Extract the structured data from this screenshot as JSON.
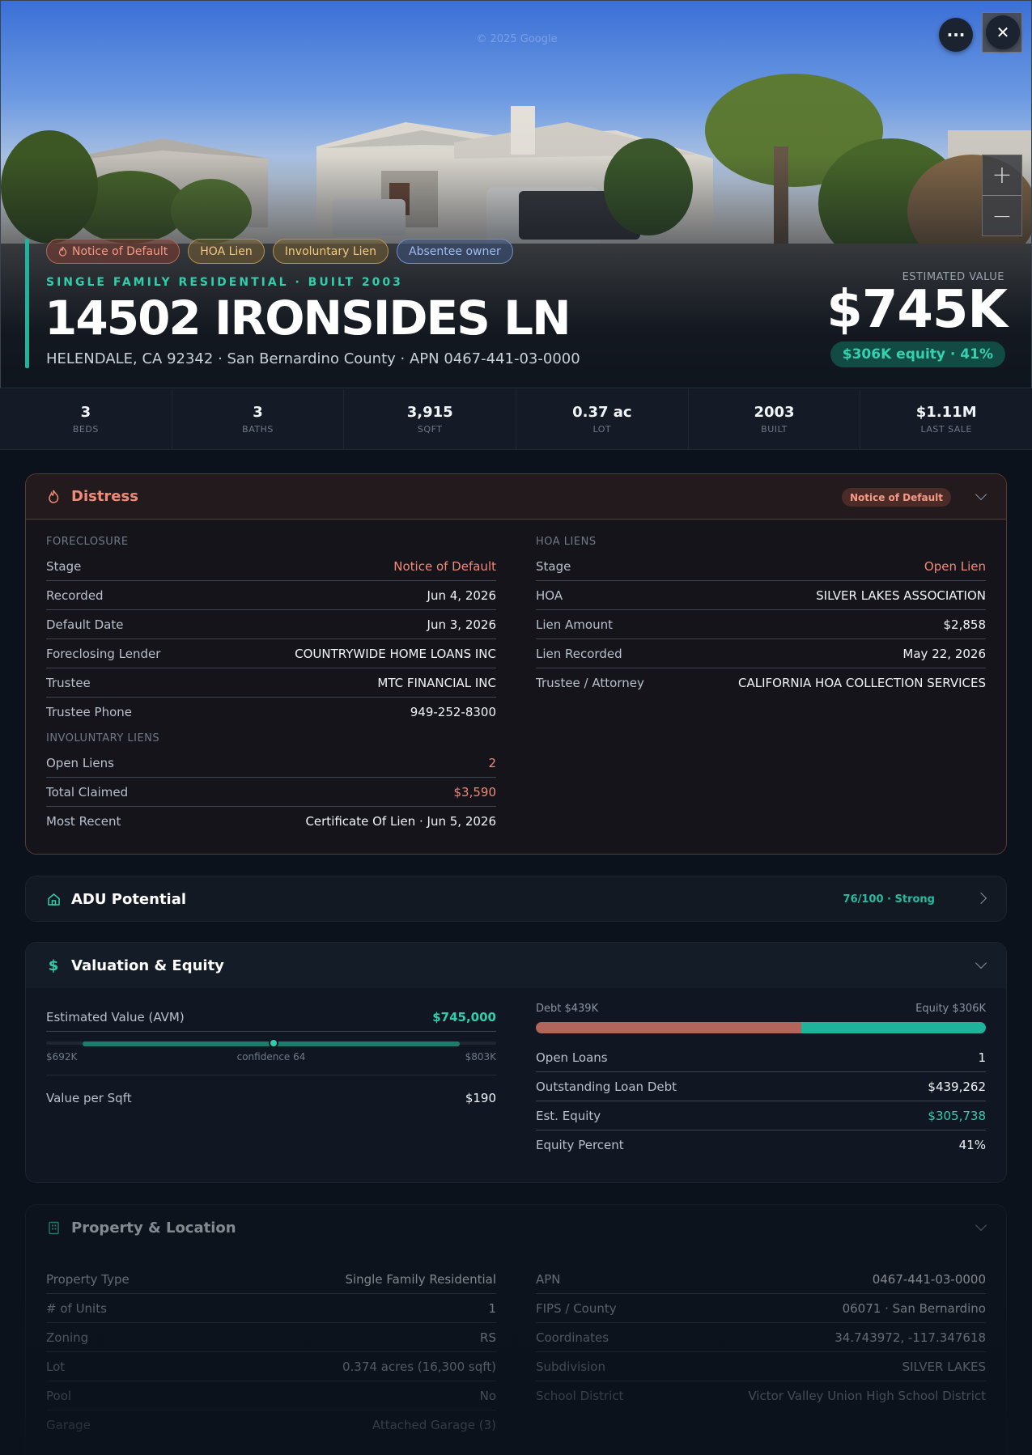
{
  "hero": {
    "watermark": "© 2025 Google",
    "more_glyph": "···",
    "close_glyph": "✕",
    "zoom_in_glyph": "+",
    "zoom_out_glyph": "−",
    "tags": [
      {
        "label": "Notice of Default",
        "icon": "flame-icon"
      },
      {
        "label": "HOA Lien"
      },
      {
        "label": "Involuntary Lien"
      },
      {
        "label": "Absentee owner"
      }
    ],
    "subtitle": "SINGLE FAMILY RESIDENTIAL · BUILT 2003",
    "address": "14502 IRONSIDES LN",
    "location_line": "HELENDALE, CA 92342 · San Bernardino County · APN 0467-441-03-0000",
    "estimated_label": "ESTIMATED VALUE",
    "estimated_value": "$745K",
    "equity_pill": "$306K equity · 41%"
  },
  "stats": [
    {
      "value": "3",
      "label": "BEDS"
    },
    {
      "value": "3",
      "label": "BATHS"
    },
    {
      "value": "3,915",
      "label": "SQFT"
    },
    {
      "value": "0.37 ac",
      "label": "LOT"
    },
    {
      "value": "2003",
      "label": "BUILT"
    },
    {
      "value": "$1.11M",
      "label": "LAST SALE"
    }
  ],
  "distress": {
    "title": "Distress",
    "badge": "Notice of Default",
    "foreclosure": {
      "label": "FORECLOSURE",
      "rows": [
        {
          "k": "Stage",
          "v": "Notice of Default"
        },
        {
          "k": "Recorded",
          "v": "Jun 4, 2026"
        },
        {
          "k": "Default Date",
          "v": "Jun 3, 2026"
        },
        {
          "k": "Foreclosing Lender",
          "v": "COUNTRYWIDE HOME LOANS INC"
        },
        {
          "k": "Trustee",
          "v": "MTC FINANCIAL INC"
        },
        {
          "k": "Trustee Phone",
          "v": "949-252-8300"
        }
      ]
    },
    "involuntary": {
      "label": "INVOLUNTARY LIENS",
      "rows": [
        {
          "k": "Open Liens",
          "v": "2"
        },
        {
          "k": "Total Claimed",
          "v": "$3,590"
        },
        {
          "k": "Most Recent",
          "v": "Certificate Of Lien · Jun 5, 2026"
        }
      ]
    },
    "hoa": {
      "label": "HOA LIENS",
      "rows": [
        {
          "k": "Stage",
          "v": "Open Lien"
        },
        {
          "k": "HOA",
          "v": "SILVER LAKES ASSOCIATION"
        },
        {
          "k": "Lien Amount",
          "v": "$2,858"
        },
        {
          "k": "Lien Recorded",
          "v": "May 22, 2026"
        },
        {
          "k": "Trustee / Attorney",
          "v": "CALIFORNIA HOA COLLECTION SERVICES"
        }
      ]
    }
  },
  "adu": {
    "title": "ADU Potential",
    "badge": "76/100 · Strong",
    "score": 76
  },
  "valuation": {
    "title": "Valuation & Equity",
    "avm_label": "Estimated Value (AVM)",
    "avm_value": "$745,000",
    "range_low": "$692K",
    "confidence": "confidence 64",
    "range_high": "$803K",
    "ppsf_label": "Value per Sqft",
    "ppsf_value": "$190",
    "debt_label": "Debt $439K",
    "equity_label": "Equity $306K",
    "debt_fraction": 0.59,
    "rows": [
      {
        "k": "Open Loans",
        "v": "1"
      },
      {
        "k": "Outstanding Loan Debt",
        "v": "$439,262"
      },
      {
        "k": "Est. Equity",
        "v": "$305,738"
      },
      {
        "k": "Equity Percent",
        "v": "41%"
      }
    ]
  },
  "property": {
    "title": "Property & Location",
    "left_rows": [
      {
        "k": "Property Type",
        "v": "Single Family Residential"
      },
      {
        "k": "# of Units",
        "v": "1"
      },
      {
        "k": "Zoning",
        "v": "RS"
      },
      {
        "k": "Lot",
        "v": "0.374 acres (16,300 sqft)"
      },
      {
        "k": "Pool",
        "v": "No"
      },
      {
        "k": "Garage",
        "v": "Attached Garage (3)"
      }
    ],
    "right_rows": [
      {
        "k": "APN",
        "v": "0467-441-03-0000"
      },
      {
        "k": "FIPS / County",
        "v": "06071 · San Bernardino"
      },
      {
        "k": "Coordinates",
        "v": "34.743972, -117.347618"
      },
      {
        "k": "Subdivision",
        "v": "SILVER LAKES"
      },
      {
        "k": "School District",
        "v": "Victor Valley Union High School District"
      }
    ]
  },
  "colors": {
    "accent_teal": "#1fb39b",
    "distress_red": "#f08a77",
    "debt_red": "#b2655b",
    "background": "#0c121b"
  }
}
